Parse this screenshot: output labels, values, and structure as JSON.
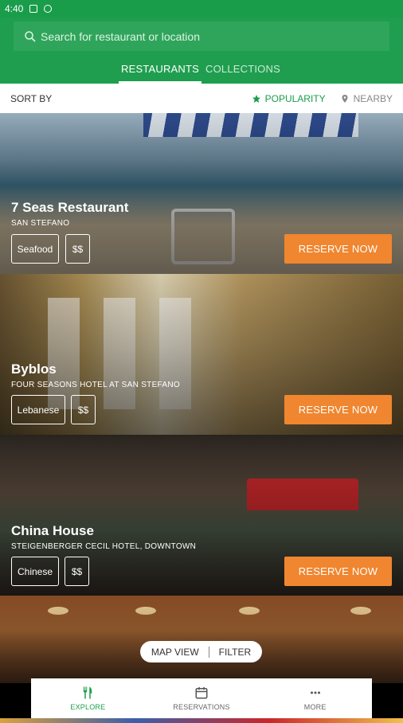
{
  "status_bar": {
    "time": "4:40"
  },
  "search": {
    "placeholder": "Search for restaurant or location"
  },
  "tabs": [
    {
      "label": "RESTAURANTS",
      "active": true
    },
    {
      "label": "COLLECTIONS",
      "active": false
    }
  ],
  "sort": {
    "label": "SORT BY",
    "options": [
      {
        "label": "POPULARITY",
        "icon": "star-icon",
        "active": true
      },
      {
        "label": "NEARBY",
        "icon": "location-pin-icon",
        "active": false
      }
    ]
  },
  "restaurants": [
    {
      "name": "7 Seas Restaurant",
      "location": "SAN STEFANO",
      "cuisine": "Seafood",
      "price": "$$",
      "reserve_label": "RESERVE NOW"
    },
    {
      "name": "Byblos",
      "location": "FOUR SEASONS HOTEL AT SAN STEFANO",
      "cuisine": "Lebanese",
      "price": "$$",
      "reserve_label": "RESERVE NOW"
    },
    {
      "name": "China House",
      "location": "STEIGENBERGER CECIL HOTEL, DOWNTOWN",
      "cuisine": "Chinese",
      "price": "$$",
      "reserve_label": "RESERVE NOW"
    }
  ],
  "map_pill": {
    "map_label": "MAP VIEW",
    "filter_label": "FILTER"
  },
  "bottom_nav": [
    {
      "label": "EXPLORE",
      "icon": "fork-knife-icon",
      "active": true
    },
    {
      "label": "RESERVATIONS",
      "icon": "calendar-icon",
      "active": false
    },
    {
      "label": "MORE",
      "icon": "more-dots-icon",
      "active": false
    }
  ],
  "colors": {
    "brand_green": "#1f9e4f",
    "reserve_orange": "#f0862f"
  }
}
